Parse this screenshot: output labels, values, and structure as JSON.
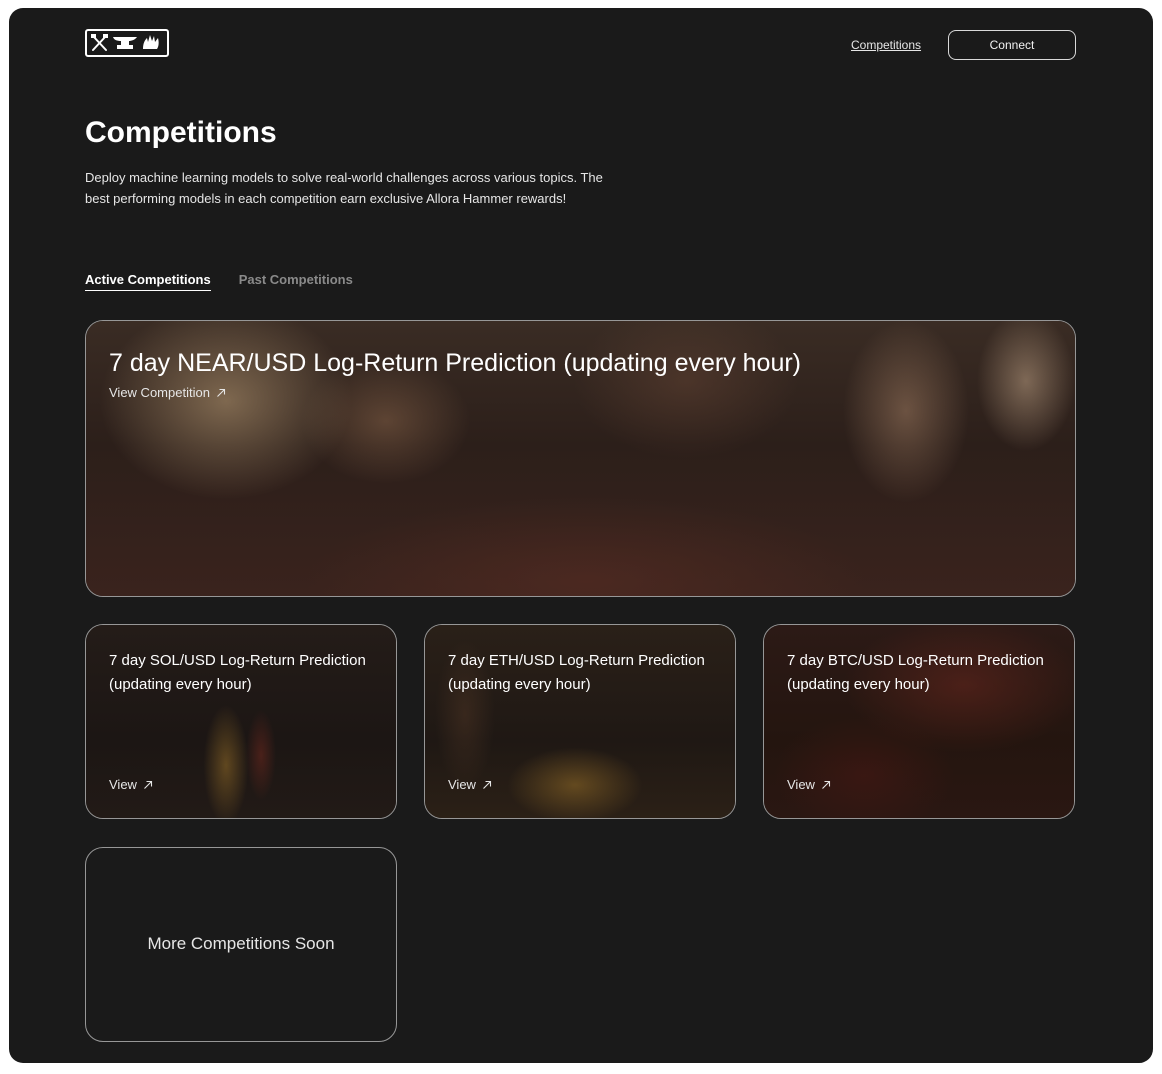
{
  "header": {
    "logo_alt": "Allora Hammer logo",
    "nav_competitions": "Competitions",
    "connect_label": "Connect"
  },
  "page": {
    "title": "Competitions",
    "description": "Deploy machine learning models to solve real-world challenges across various topics. The best performing models in each competition earn exclusive Allora Hammer rewards!"
  },
  "tabs": [
    {
      "label": "Active Competitions",
      "active": true
    },
    {
      "label": "Past Competitions",
      "active": false
    }
  ],
  "featured": {
    "title": "7 day NEAR/USD Log-Return Prediction (updating every hour)",
    "link_label": "View Competition"
  },
  "cards": [
    {
      "title": "7 day SOL/USD Log-Return Prediction (updating every hour)",
      "link_label": "View"
    },
    {
      "title": "7 day ETH/USD Log-Return Prediction (updating every hour)",
      "link_label": "View"
    },
    {
      "title": "7 day BTC/USD Log-Return Prediction (updating every hour)",
      "link_label": "View"
    }
  ],
  "placeholder": {
    "label": "More Competitions Soon"
  },
  "icons": {
    "logo": "hammer-anvil-hand-logo",
    "link_arrow": "arrow-up-right-icon"
  },
  "colors": {
    "background": "#1a1a1a",
    "text": "#ffffff",
    "muted": "#8a8a8a",
    "card_border": "#d9d9d9"
  }
}
